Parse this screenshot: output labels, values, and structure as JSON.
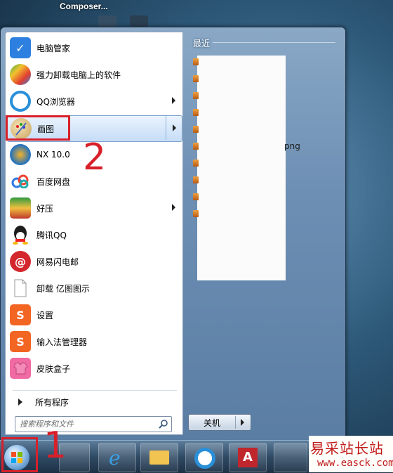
{
  "desktop": {
    "title": "Composer..."
  },
  "start_menu": {
    "programs": [
      {
        "label": "电脑管家",
        "icon": "shield-icon",
        "color": "#2d7fe0",
        "has_arrow": false
      },
      {
        "label": "强力卸载电脑上的软件",
        "icon": "uninstall-icon",
        "color": "#3cb44a",
        "has_arrow": false
      },
      {
        "label": "QQ浏览器",
        "icon": "qq-browser-icon",
        "color": "#2a8fd9",
        "has_arrow": true
      },
      {
        "label": "画图",
        "icon": "paint-icon",
        "color": "#caa35a",
        "has_arrow": true
      },
      {
        "label": "NX 10.0",
        "icon": "nx-icon",
        "color": "#1b6fc4",
        "has_arrow": false
      },
      {
        "label": "百度网盘",
        "icon": "baidu-netdisk-icon",
        "color": "#2f79e6",
        "has_arrow": false
      },
      {
        "label": "好压",
        "icon": "haozip-icon",
        "color": "#2f9a3f",
        "has_arrow": true
      },
      {
        "label": "腾讯QQ",
        "icon": "qq-icon",
        "color": "#222222",
        "has_arrow": false
      },
      {
        "label": "网易闪电邮",
        "icon": "netease-mail-icon",
        "color": "#d3262d",
        "has_arrow": false
      },
      {
        "label": "卸载 亿图图示",
        "icon": "document-icon",
        "color": "#e8e8e8",
        "has_arrow": false
      },
      {
        "label": "设置",
        "icon": "sogou-settings-icon",
        "color": "#f26522",
        "has_arrow": false
      },
      {
        "label": "输入法管理器",
        "icon": "sogou-ime-icon",
        "color": "#f26522",
        "has_arrow": false
      },
      {
        "label": "皮肤盒子",
        "icon": "skin-box-icon",
        "color": "#f06aa3",
        "has_arrow": false
      }
    ],
    "all_programs": "所有程序",
    "search_placeholder": "搜索程序和文件",
    "recent_title": "最近",
    "recent_visible_text": "png",
    "shutdown_label": "关机"
  },
  "annotations": {
    "number_1": "1",
    "number_2": "2"
  },
  "watermark": {
    "title": "易采站长站",
    "url": "www.easck.com"
  },
  "colors": {
    "highlight": "#c6ddf7",
    "annotation_red": "#d8202a"
  }
}
